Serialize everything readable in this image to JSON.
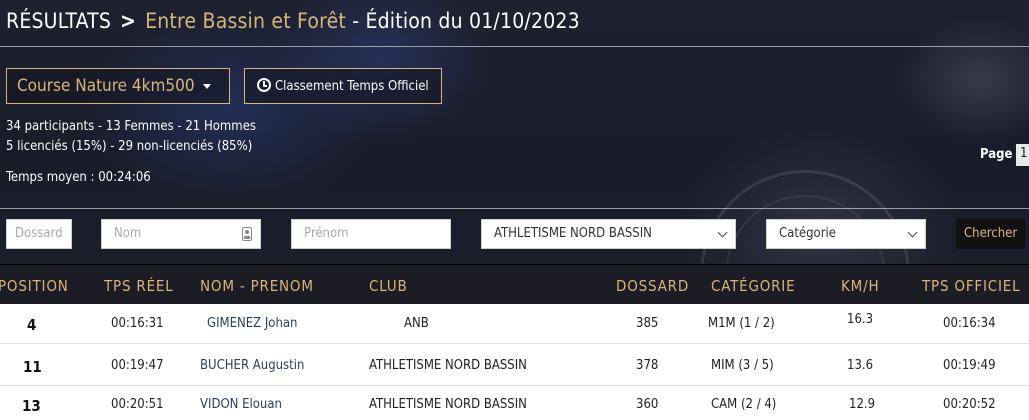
{
  "header": {
    "results_label": "RÉSULTATS",
    "separator": ">",
    "event_name": "Entre Bassin et Forêt",
    "edition": "- Édition du 01/10/2023"
  },
  "controls": {
    "race_select_value": "Course Nature 4km500",
    "official_ranking_label": "Classement Temps Officiel"
  },
  "stats": {
    "participants": "34 participants - 13 Femmes - 21 Hommes",
    "licences": "5 licenciés (15%) - 29 non-licenciés (85%)",
    "avg_time": "Temps moyen : 00:24:06"
  },
  "pagination": {
    "label": "Page",
    "current": "1"
  },
  "filters": {
    "bib_placeholder": "Dossard",
    "last_name_placeholder": "Nom",
    "first_name_placeholder": "Prénom",
    "club_selected": "ATHLETISME NORD BASSIN",
    "category_selected": "Catégorie",
    "search_label": "Chercher"
  },
  "table": {
    "headers": {
      "position": "POSITION",
      "real_time": "TPS RÉEL",
      "name": "NOM - PRENOM",
      "club": "CLUB",
      "bib": "DOSSARD",
      "category": "CATÉGORIE",
      "speed": "KM/H",
      "official_time": "TPS OFFICIEL"
    },
    "rows": [
      {
        "position": "4",
        "real_time": "00:16:31",
        "name": "GIMENEZ Johan",
        "club": "ANB",
        "bib": "385",
        "category": "M1M (1 / 2)",
        "speed": "16.3",
        "official_time": "00:16:34"
      },
      {
        "position": "11",
        "real_time": "00:19:47",
        "name": "BUCHER Augustin",
        "club": "ATHLETISME NORD BASSIN",
        "bib": "378",
        "category": "MIM (3 / 5)",
        "speed": "13.6",
        "official_time": "00:19:49"
      },
      {
        "position": "13",
        "real_time": "00:20:51",
        "name": "VIDON Elouan",
        "club": "ATHLETISME NORD BASSIN",
        "bib": "360",
        "category": "CAM (2 / 4)",
        "speed": "12.9",
        "official_time": "00:20:52"
      }
    ]
  },
  "colors": {
    "accent_gold": "#d8b57a",
    "header_bg": "#1b1c24",
    "name_blue": "#2c3e5e"
  }
}
